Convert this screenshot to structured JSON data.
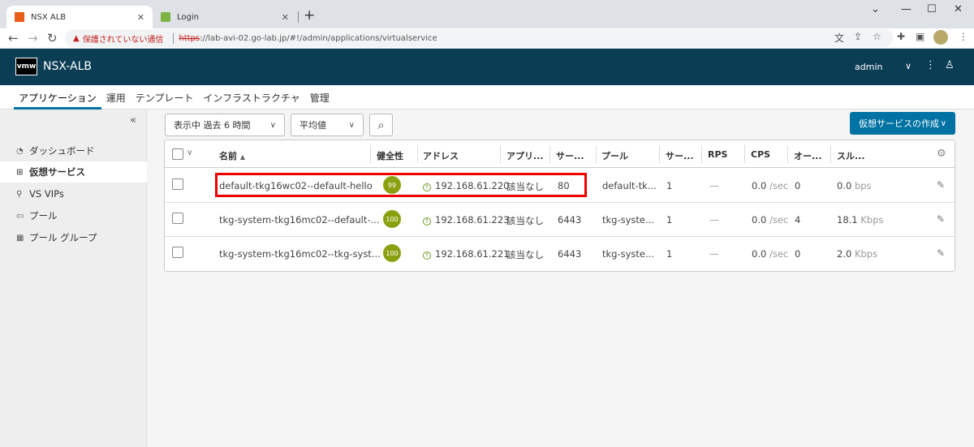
{
  "browser": {
    "tabs": [
      {
        "title": "NSX ALB",
        "active": true
      },
      {
        "title": "Login",
        "active": false
      }
    ],
    "security_label": "保護されていない通信",
    "url_scheme": "https",
    "url_rest": "://lab-avi-02.go-lab.jp/#!/admin/applications/virtualservice"
  },
  "header": {
    "logo": "vmw",
    "app_name": "NSX-ALB",
    "user": "admin"
  },
  "topnav": [
    "アプリケーション",
    "運用",
    "テンプレート",
    "インフラストラクチャ",
    "管理"
  ],
  "sidebar": [
    {
      "label": "ダッシュボード",
      "icon": "dashboard-icon"
    },
    {
      "label": "仮想サービス",
      "icon": "virtual-service-icon",
      "active": true
    },
    {
      "label": "VS VIPs",
      "icon": "location-pin-icon"
    },
    {
      "label": "プール",
      "icon": "pool-icon"
    },
    {
      "label": "プール グループ",
      "icon": "pool-group-icon"
    }
  ],
  "toolbar": {
    "time_filter": "表示中 過去 6 時間",
    "metric_filter": "平均値",
    "create_button": "仮想サービスの作成"
  },
  "columns": [
    "名前",
    "健全性",
    "アドレス",
    "アプリ...",
    "サー...",
    "プール",
    "サー...",
    "RPS",
    "CPS",
    "オー...",
    "スル..."
  ],
  "rows": [
    {
      "name": "default-tkg16wc02--default-hello",
      "health": "99",
      "address": "192.168.61.220",
      "app": "該当なし",
      "port": "80",
      "pool": "default-tk...",
      "servers": "1",
      "rps": "—",
      "cps": "0.0",
      "cps_unit": "/sec",
      "open": "0",
      "thr": "0.0",
      "thr_unit": "bps"
    },
    {
      "name": "tkg-system-tkg16mc02--default-...",
      "health": "100",
      "address": "192.168.61.223",
      "app": "該当なし",
      "port": "6443",
      "pool": "tkg-syste...",
      "servers": "1",
      "rps": "—",
      "cps": "0.0",
      "cps_unit": "/sec",
      "open": "4",
      "thr": "18.1",
      "thr_unit": "Kbps"
    },
    {
      "name": "tkg-system-tkg16mc02--tkg-syst...",
      "health": "100",
      "address": "192.168.61.221",
      "app": "該当なし",
      "port": "6443",
      "pool": "tkg-syste...",
      "servers": "1",
      "rps": "—",
      "cps": "0.0",
      "cps_unit": "/sec",
      "open": "0",
      "thr": "2.0",
      "thr_unit": "Kbps"
    }
  ],
  "colors": {
    "header_bg": "#0b3d55",
    "accent": "#0072a3",
    "health": "#8aa010",
    "highlight": "#e00000"
  }
}
